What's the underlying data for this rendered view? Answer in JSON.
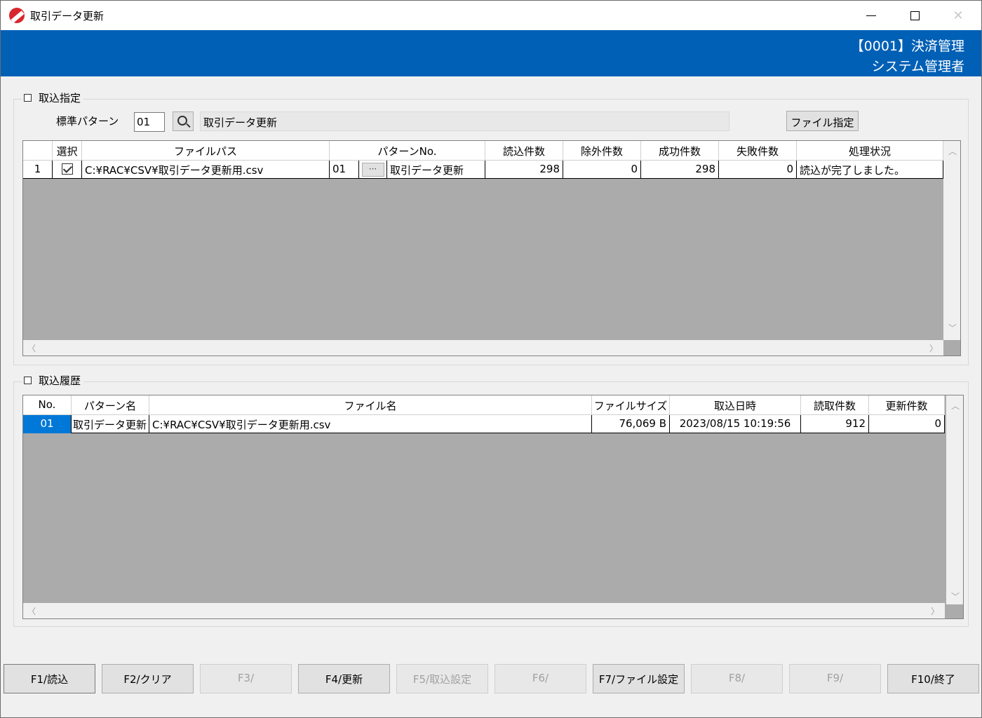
{
  "window": {
    "title": "取引データ更新"
  },
  "header": {
    "line1": "【0001】決済管理",
    "line2": "システム管理者"
  },
  "import_group": {
    "title": "取込指定",
    "pattern_label": "標準パターン",
    "pattern_code": "01",
    "pattern_name": "取引データ更新",
    "file_button": "ファイル指定",
    "columns": [
      "選択",
      "ファイルパス",
      "パターンNo.",
      "読込件数",
      "除外件数",
      "成功件数",
      "失敗件数",
      "処理状況"
    ],
    "rows": [
      {
        "row_no": "1",
        "selected": true,
        "file_path": "C:¥RAC¥CSV¥取引データ更新用.csv",
        "pattern_no": "01",
        "pattern_btn": "···",
        "pattern_name": "取引データ更新",
        "read": "298",
        "excluded": "0",
        "success": "298",
        "failed": "0",
        "status": "読込が完了しました。"
      }
    ]
  },
  "history_group": {
    "title": "取込履歴",
    "columns": [
      "No.",
      "パターン名",
      "ファイル名",
      "ファイルサイズ",
      "取込日時",
      "読取件数",
      "更新件数"
    ],
    "rows": [
      {
        "no": "01",
        "pattern_name": "取引データ更新",
        "file_name": "C:¥RAC¥CSV¥取引データ更新用.csv",
        "file_size": "76,069 B",
        "imported_at": "2023/08/15 10:19:56",
        "read": "912",
        "updated": "0"
      }
    ]
  },
  "function_keys": [
    {
      "label": "F1/読込",
      "enabled": true
    },
    {
      "label": "F2/クリア",
      "enabled": true
    },
    {
      "label": "F3/",
      "enabled": false
    },
    {
      "label": "F4/更新",
      "enabled": true
    },
    {
      "label": "F5/取込設定",
      "enabled": false
    },
    {
      "label": "F6/",
      "enabled": false
    },
    {
      "label": "F7/ファイル設定",
      "enabled": true
    },
    {
      "label": "F8/",
      "enabled": false
    },
    {
      "label": "F9/",
      "enabled": false
    },
    {
      "label": "F10/終了",
      "enabled": true
    }
  ],
  "icons": {
    "app": "app-logo-icon",
    "search": "search-icon",
    "checkbox": "checkbox-checked-icon"
  },
  "colors": {
    "header": "#0060b6",
    "selection": "#0078d7",
    "grid_empty": "#ababab"
  }
}
